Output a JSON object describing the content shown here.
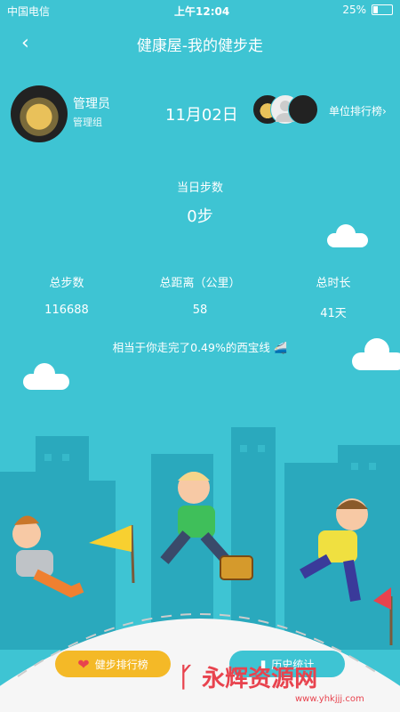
{
  "status": {
    "carrier": "中国电信",
    "time": "上午12:04",
    "battery": "25%"
  },
  "nav": {
    "title": "健康屋-我的健步走"
  },
  "profile": {
    "name": "管理员",
    "group": "管理组",
    "date": "11月02日",
    "rank_link": "单位排行榜"
  },
  "today": {
    "label": "当日步数",
    "value": "0步"
  },
  "stats": [
    {
      "label": "总步数",
      "value": "116688"
    },
    {
      "label": "总距离（公里）",
      "value": "58"
    },
    {
      "label": "总时长",
      "value": "41天"
    }
  ],
  "equivalent": "相当于你走完了0.49%的西宝线",
  "buttons": {
    "rank": "健步排行榜",
    "history": "历史统计"
  },
  "watermark": {
    "brand": "永辉资源网",
    "url": "www.yhkjjj.com"
  },
  "colors": {
    "background": "#3ec4d3",
    "building": "#2aa9bd",
    "button_orange": "#f4b927",
    "watermark_red": "#e8434e"
  }
}
